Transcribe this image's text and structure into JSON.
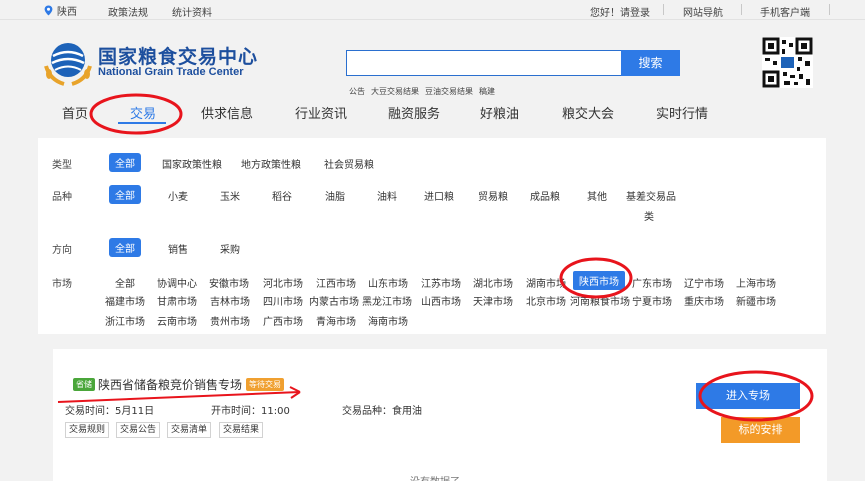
{
  "topbar": {
    "location": "陕西",
    "links": [
      "政策法规",
      "统计资料"
    ],
    "greeting": "您好！请登录",
    "site_nav": "网站导航",
    "mobile": "手机客户端"
  },
  "header": {
    "logo_cn": "国家粮食交易中心",
    "logo_en": "National Grain Trade Center",
    "search_placeholder": "",
    "search_button": "搜索",
    "hotwords": [
      "公告",
      "大豆交易结果",
      "豆油交易结果",
      "稿建"
    ]
  },
  "nav": {
    "items": [
      "首页",
      "交易",
      "供求信息",
      "行业资讯",
      "融资服务",
      "好粮油",
      "粮交大会",
      "实时行情"
    ],
    "active": "交易"
  },
  "filters": {
    "type": {
      "label": "类型",
      "options": [
        "全部",
        "国家政策性粮",
        "地方政策性粮",
        "社会贸易粮"
      ],
      "selected": "全部"
    },
    "variety": {
      "label": "品种",
      "options": [
        "全部",
        "小麦",
        "玉米",
        "稻谷",
        "油脂",
        "油料",
        "进口粮",
        "贸易粮",
        "成品粮",
        "其他",
        "基差交易品",
        "类"
      ],
      "selected": "全部"
    },
    "direction": {
      "label": "方向",
      "options": [
        "全部",
        "销售",
        "采购"
      ],
      "selected": "全部"
    },
    "market": {
      "label": "市场",
      "row1": [
        "全部",
        "协调中心",
        "安徽市场",
        "河北市场",
        "江西市场",
        "山东市场",
        "江苏市场",
        "湖北市场",
        "湖南市场",
        "陕西市场",
        "广东市场",
        "辽宁市场",
        "上海市场"
      ],
      "row2": [
        "福建市场",
        "甘肃市场",
        "吉林市场",
        "四川市场",
        "内蒙古市场",
        "黑龙江市场",
        "山西市场",
        "天津市场",
        "北京市场",
        "河南粮食市场",
        "宁夏市场",
        "重庆市场",
        "新疆市场"
      ],
      "row3": [
        "浙江市场",
        "云南市场",
        "贵州市场",
        "广西市场",
        "青海市场",
        "海南市场"
      ],
      "selected": "陕西市场"
    }
  },
  "listing": {
    "badge": "省储",
    "title": "陕西省储备粮竞价销售专场",
    "status": "等待交易",
    "trade_time": "交易时间：5月11日",
    "open_time": "开市时间：11:00",
    "variety": "交易品种：食用油",
    "buttons": [
      "交易规则",
      "交易公告",
      "交易清单",
      "交易结果"
    ],
    "enter": "进入专场",
    "schedule": "标的安排",
    "no_data": "没有数据了"
  },
  "colors": {
    "primary": "#2e7ae6",
    "orange": "#f39a28",
    "green": "#4aa63a",
    "annotation": "#e8141c"
  }
}
